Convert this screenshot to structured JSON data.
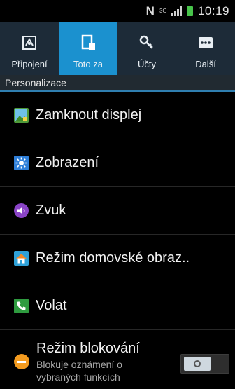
{
  "status_bar": {
    "nfc": "N",
    "network": "3G",
    "time": "10:19",
    "battery_color": "#47c44a"
  },
  "tabs": [
    {
      "label": "Připojení",
      "icon": "connections-icon",
      "active": false
    },
    {
      "label": "Toto za",
      "icon": "device-icon",
      "active": true
    },
    {
      "label": "Účty",
      "icon": "key-icon",
      "active": false
    },
    {
      "label": "Další",
      "icon": "more-icon",
      "active": false
    }
  ],
  "section": {
    "title": "Personalizace"
  },
  "items": [
    {
      "label": "Zamknout displej",
      "icon": "lock-screen-icon",
      "color": "#4f9a3a"
    },
    {
      "label": "Zobrazení",
      "icon": "display-icon",
      "color": "#2f7fd8"
    },
    {
      "label": "Zvuk",
      "icon": "sound-icon",
      "color": "#8a44c7"
    },
    {
      "label": "Režim domovské obraz..",
      "icon": "home-screen-icon",
      "color": "#2fa1d8"
    },
    {
      "label": "Volat",
      "icon": "call-icon",
      "color": "#2e9b3f"
    }
  ],
  "blocking": {
    "label": "Režim blokování",
    "subtitle": "Blokuje oznámení o vybraných funkcích",
    "icon": "block-icon",
    "color": "#f39b1f",
    "toggle": "off"
  },
  "colors": {
    "tab_bar": "#1d2b38",
    "tab_active": "#1b91cf",
    "section_header": "#212a31"
  }
}
